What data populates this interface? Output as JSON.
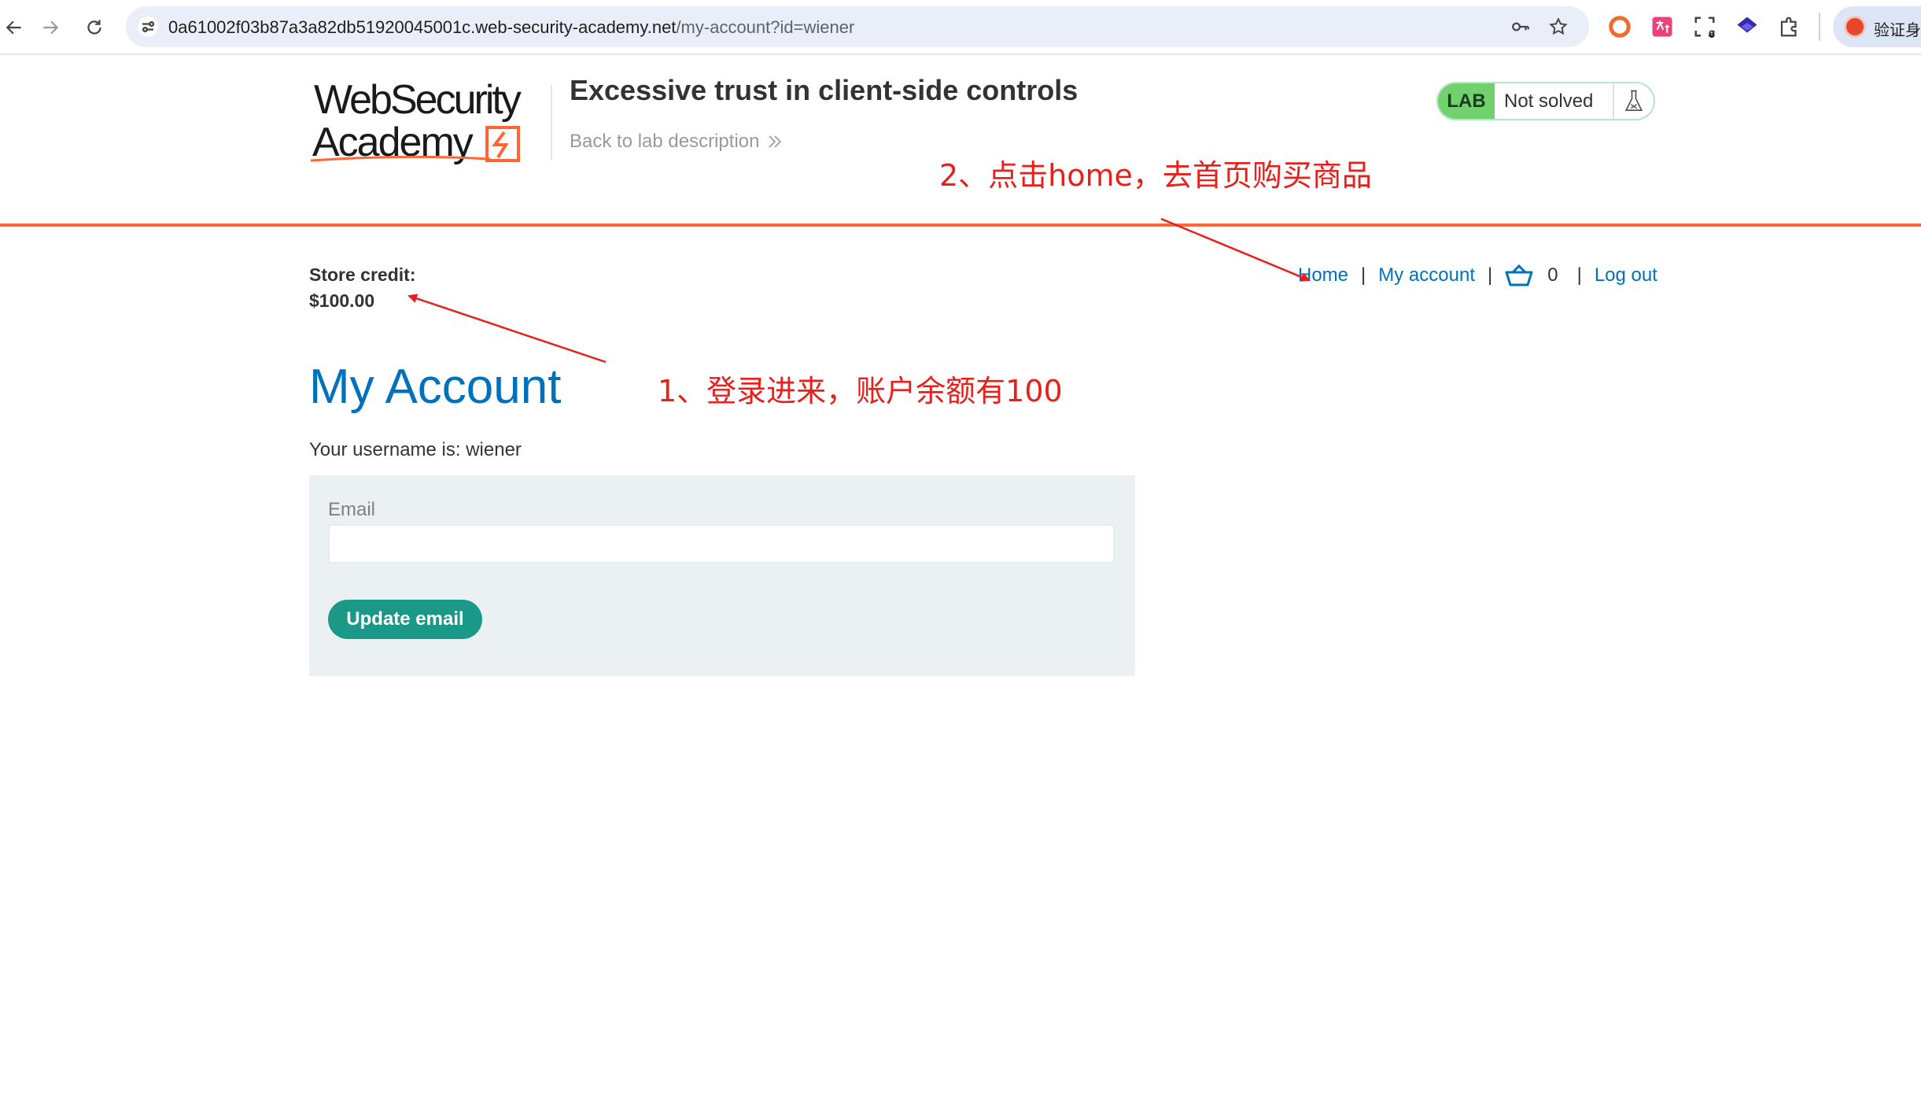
{
  "browser": {
    "url_host": "0a61002f03b87a3a82db51920045001c.web-security-academy.net",
    "url_path": "/my-account?id=wiener",
    "extensions_badge": "6",
    "profile_label": "验证身份"
  },
  "header": {
    "logo_line1": "WebSecurity",
    "logo_line2": "Academy",
    "lab_title": "Excessive trust in client-side controls",
    "back_link": "Back to lab description",
    "lab_badge": "LAB",
    "lab_status": "Not solved",
    "colors": {
      "accent_rule": "#ff6633",
      "lab_badge": "#70d16d"
    }
  },
  "account_bar": {
    "credit_label": "Store credit:",
    "credit_value": "$100.00",
    "nav": {
      "home": "Home",
      "separator": "|",
      "my_account": "My account",
      "cart_count": "0",
      "log_out": "Log out"
    }
  },
  "main": {
    "heading": "My Account",
    "username_line": "Your username is: wiener",
    "email_label": "Email",
    "email_value": "",
    "update_button": "Update email",
    "colors": {
      "link": "#0071bc",
      "button": "#1a9988",
      "panel": "#ebf0f2"
    }
  },
  "annotations": {
    "note1": "1、登录进来，账户余额有100",
    "note2": "2、点击home，去首页购买商品",
    "color": "#e8201c"
  }
}
